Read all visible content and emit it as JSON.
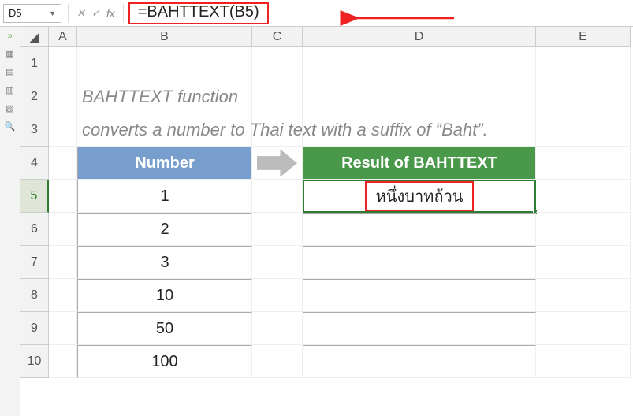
{
  "name_box": {
    "value": "D5"
  },
  "formula_bar": {
    "formula": "=BAHTTEXT(B5)"
  },
  "description": {
    "line1": "BAHTTEXT function",
    "line2": "converts a number to Thai text with a suffix of “Baht”."
  },
  "columns": [
    "A",
    "B",
    "C",
    "D",
    "E"
  ],
  "row_numbers": [
    "1",
    "2",
    "3",
    "4",
    "5",
    "6",
    "7",
    "8",
    "9",
    "10"
  ],
  "table": {
    "number_header": "Number",
    "result_header": "Result of BAHTTEXT",
    "numbers": [
      "1",
      "2",
      "3",
      "10",
      "50",
      "100"
    ],
    "results": [
      "หนึ่งบาทถ้วน",
      "",
      "",
      "",
      "",
      ""
    ]
  },
  "selected_cell_ref": "D5"
}
